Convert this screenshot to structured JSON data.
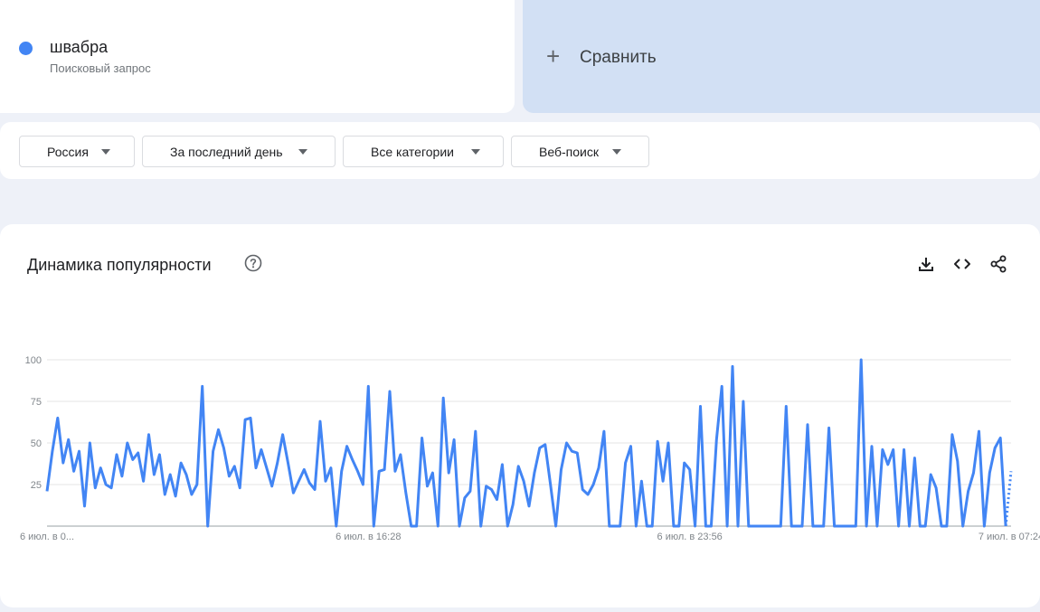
{
  "term": {
    "name": "швабра",
    "type": "Поисковый запрос",
    "color": "#4285f4"
  },
  "compare": {
    "label": "Сравнить"
  },
  "filters": [
    {
      "label": "Россия"
    },
    {
      "label": "За последний день"
    },
    {
      "label": "Все категории"
    },
    {
      "label": "Веб-поиск"
    }
  ],
  "chart": {
    "title": "Динамика популярности"
  },
  "chart_data": {
    "type": "line",
    "title": "Динамика популярности",
    "xlabel": "",
    "ylabel": "",
    "ylim": [
      0,
      100
    ],
    "yticks": [
      25,
      50,
      75,
      100
    ],
    "xtick_labels": [
      "6 июл. в 0...",
      "6 июл. в 16:28",
      "6 июл. в 23:56",
      "7 июл. в 07:24"
    ],
    "xtick_positions": [
      0,
      60,
      120,
      180
    ],
    "grid": true,
    "series": [
      {
        "color": "#4285f4",
        "partial_last_point": true,
        "values": [
          21,
          45,
          65,
          38,
          52,
          33,
          45,
          12,
          50,
          23,
          35,
          25,
          23,
          43,
          30,
          50,
          40,
          44,
          27,
          55,
          31,
          43,
          19,
          31,
          18,
          38,
          31,
          19,
          25,
          84,
          0,
          45,
          58,
          47,
          30,
          36,
          23,
          64,
          65,
          35,
          46,
          35,
          24,
          38,
          55,
          38,
          20,
          27,
          34,
          26,
          22,
          63,
          27,
          35,
          0,
          33,
          48,
          40,
          33,
          25,
          84,
          0,
          33,
          34,
          81,
          33,
          43,
          20,
          0,
          0,
          53,
          24,
          32,
          0,
          77,
          32,
          52,
          0,
          17,
          21,
          57,
          0,
          24,
          22,
          16,
          37,
          0,
          13,
          36,
          27,
          12,
          32,
          47,
          49,
          25,
          0,
          34,
          50,
          45,
          44,
          22,
          19,
          25,
          35,
          57,
          0,
          0,
          0,
          38,
          48,
          0,
          27,
          0,
          0,
          51,
          27,
          50,
          0,
          0,
          38,
          34,
          0,
          72,
          0,
          0,
          52,
          84,
          0,
          96,
          0,
          75,
          0,
          0,
          0,
          0,
          0,
          0,
          0,
          72,
          0,
          0,
          0,
          61,
          0,
          0,
          0,
          59,
          0,
          0,
          0,
          0,
          0,
          100,
          0,
          48,
          0,
          46,
          37,
          46,
          0,
          46,
          0,
          41,
          0,
          0,
          31,
          23,
          0,
          0,
          55,
          39,
          0,
          21,
          32,
          57,
          0,
          32,
          47,
          53,
          0,
          33
        ]
      }
    ]
  }
}
